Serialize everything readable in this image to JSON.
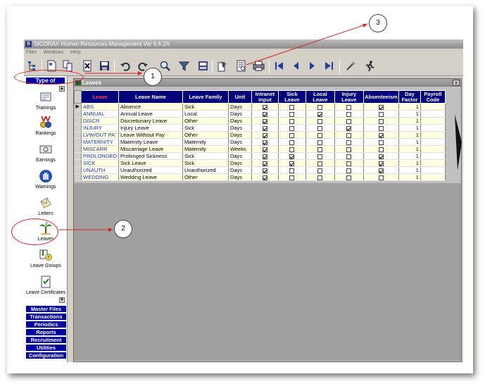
{
  "window": {
    "title": "SICORAX Human Resources Management Ver 6.6.2A",
    "logo_letter": "S"
  },
  "menu": [
    "Files",
    "Windows",
    "Help"
  ],
  "toolbar_icons": [
    "tree-icon",
    "new-document-icon",
    "copy-icon",
    "delete-icon",
    "save-icon",
    "undo-icon",
    "redo-icon",
    "find-icon",
    "filter-icon",
    "print-preview-icon",
    "export-icon",
    "report-icon",
    "print-icon",
    "first-record-icon",
    "prev-record-icon",
    "next-record-icon",
    "last-record-icon",
    "wand-icon",
    "exit-runner-icon"
  ],
  "leftnav": {
    "header": "Type of",
    "items": [
      {
        "label": "Trainings",
        "icon": "trainings-icon"
      },
      {
        "label": "Rankings",
        "icon": "rankings-medal-icon"
      },
      {
        "label": "Earnings",
        "icon": "earnings-icon"
      },
      {
        "label": "Warnings",
        "icon": "warnings-hand-icon"
      },
      {
        "label": "Letters",
        "icon": "letters-envelope-icon"
      },
      {
        "label": "Leaves",
        "icon": "leaves-palm-tree-icon"
      },
      {
        "label": "Leave Groups",
        "icon": "leave-groups-icon"
      },
      {
        "label": "Leave Certificates",
        "icon": "leave-certificates-icon"
      }
    ],
    "groups": [
      "Master Files",
      "Transactions",
      "Periodics",
      "Reports",
      "Recruitment",
      "Utilities",
      "Configuration"
    ]
  },
  "leaves_window": {
    "title": "Leaves",
    "close_label": "x",
    "columns": [
      "Leave",
      "Leave Name",
      "Leave Family",
      "Unit",
      "Intranet Input",
      "Sick Leave",
      "Local Leave",
      "Injury Leave",
      "Absenteeism",
      "Day Factor",
      "Payroll Code"
    ],
    "rows": [
      {
        "code": "ABS",
        "name": "Absence",
        "family": "Sick",
        "unit": "Days",
        "intranet": true,
        "sick": false,
        "local": false,
        "injury": false,
        "absent": true,
        "factor": "1",
        "payroll": ""
      },
      {
        "code": "ANNUAL",
        "name": "Annual Leave",
        "family": "Local",
        "unit": "Days",
        "intranet": true,
        "sick": false,
        "local": true,
        "injury": false,
        "absent": false,
        "factor": "1",
        "payroll": ""
      },
      {
        "code": "DISCR",
        "name": "Discretionary Leave",
        "family": "Other",
        "unit": "Days",
        "intranet": true,
        "sick": false,
        "local": false,
        "injury": false,
        "absent": false,
        "factor": "1",
        "payroll": ""
      },
      {
        "code": "INJURY",
        "name": "Injury Leave",
        "family": "Sick",
        "unit": "Days",
        "intranet": true,
        "sick": false,
        "local": false,
        "injury": true,
        "absent": false,
        "factor": "1",
        "payroll": ""
      },
      {
        "code": "LVW/OUT PA'",
        "name": "Leave Without Pay",
        "family": "Other",
        "unit": "Days",
        "intranet": true,
        "sick": false,
        "local": false,
        "injury": false,
        "absent": true,
        "factor": "1",
        "payroll": ""
      },
      {
        "code": "MATERNITY",
        "name": "Maternity Leave",
        "family": "Maternity",
        "unit": "Days",
        "intranet": true,
        "sick": false,
        "local": false,
        "injury": false,
        "absent": false,
        "factor": "1",
        "payroll": ""
      },
      {
        "code": "MISCARR",
        "name": "Miscarriage Leave",
        "family": "Maternity",
        "unit": "Weeks",
        "intranet": true,
        "sick": false,
        "local": false,
        "injury": false,
        "absent": false,
        "factor": "1",
        "payroll": ""
      },
      {
        "code": "PROLONGED",
        "name": "Prolonged Sickness",
        "family": "Sick",
        "unit": "Days",
        "intranet": true,
        "sick": true,
        "local": false,
        "injury": false,
        "absent": true,
        "factor": "1",
        "payroll": ""
      },
      {
        "code": "SICK",
        "name": "Sick Leave",
        "family": "Sick",
        "unit": "Days",
        "intranet": true,
        "sick": true,
        "local": false,
        "injury": false,
        "absent": true,
        "factor": "1",
        "payroll": ""
      },
      {
        "code": "UNAUTH",
        "name": "Unauthorized",
        "family": "Unauthorized",
        "unit": "Days",
        "intranet": true,
        "sick": false,
        "local": false,
        "injury": false,
        "absent": true,
        "factor": "1",
        "payroll": ""
      },
      {
        "code": "WEDDING",
        "name": "Wedding Leave",
        "family": "Other",
        "unit": "Days",
        "intranet": true,
        "sick": false,
        "local": false,
        "injury": false,
        "absent": false,
        "factor": "1",
        "payroll": ""
      }
    ]
  },
  "annotations": [
    "1",
    "2",
    "3"
  ],
  "colors": {
    "nav_blue": "#0000a0",
    "header_blue": "#00007c",
    "row_odd": "#ffffe1",
    "annotation_red": "#dd2222"
  }
}
